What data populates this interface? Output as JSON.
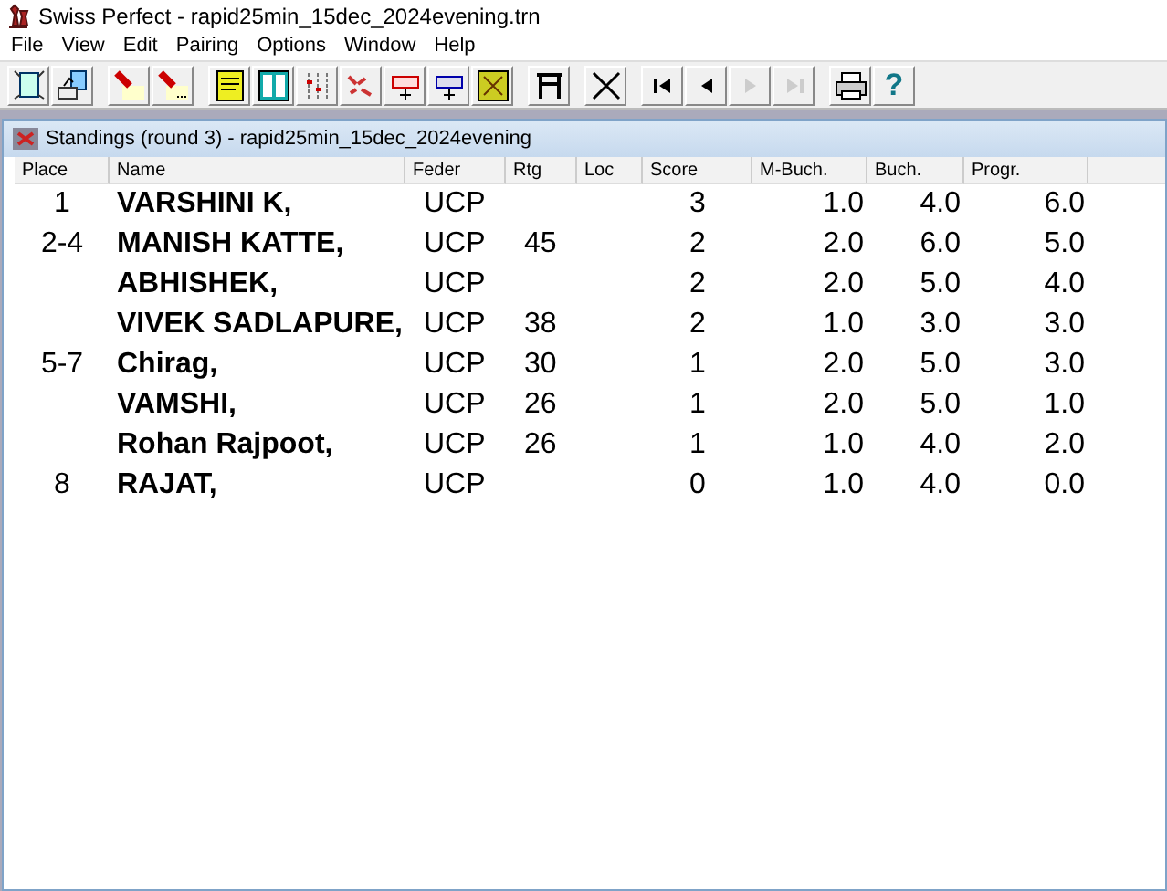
{
  "window": {
    "title": "Swiss Perfect - rapid25min_15dec_2024evening.trn"
  },
  "menu": [
    "File",
    "View",
    "Edit",
    "Pairing",
    "Options",
    "Window",
    "Help"
  ],
  "toolbar": [
    {
      "kind": "new",
      "disabled": false
    },
    {
      "kind": "open",
      "disabled": false
    },
    {
      "kind": "sep"
    },
    {
      "kind": "torch",
      "disabled": false
    },
    {
      "kind": "torch-dots",
      "disabled": false
    },
    {
      "kind": "sep"
    },
    {
      "kind": "notepad",
      "disabled": false
    },
    {
      "kind": "list",
      "disabled": false
    },
    {
      "kind": "dots",
      "disabled": false
    },
    {
      "kind": "scatter",
      "disabled": false
    },
    {
      "kind": "rednum",
      "disabled": false
    },
    {
      "kind": "bluenum",
      "disabled": false
    },
    {
      "kind": "map",
      "disabled": false
    },
    {
      "kind": "sep"
    },
    {
      "kind": "table",
      "disabled": false
    },
    {
      "kind": "sep"
    },
    {
      "kind": "cross",
      "disabled": false
    },
    {
      "kind": "sep"
    },
    {
      "kind": "first",
      "disabled": false
    },
    {
      "kind": "prev",
      "disabled": false
    },
    {
      "kind": "next",
      "disabled": true
    },
    {
      "kind": "last",
      "disabled": true
    },
    {
      "kind": "sep"
    },
    {
      "kind": "printer",
      "disabled": false
    },
    {
      "kind": "help",
      "label": "?",
      "disabled": false
    }
  ],
  "child_window": {
    "title": "Standings  (round 3) - rapid25min_15dec_2024evening"
  },
  "table": {
    "columns": [
      "Place",
      "Name",
      "Feder",
      "Rtg",
      "Loc",
      "Score",
      "M-Buch.",
      "Buch.",
      "Progr."
    ],
    "rows": [
      {
        "place": "1",
        "name": "VARSHINI K,",
        "feder": "UCP",
        "rtg": "",
        "score": "3",
        "m_buch": "1.0",
        "buch": "4.0",
        "progr": "6.0"
      },
      {
        "place": "2-4",
        "name": "MANISH KATTE,",
        "feder": "UCP",
        "rtg": "45",
        "score": "2",
        "m_buch": "2.0",
        "buch": "6.0",
        "progr": "5.0"
      },
      {
        "place": "",
        "name": "ABHISHEK,",
        "feder": "UCP",
        "rtg": "",
        "score": "2",
        "m_buch": "2.0",
        "buch": "5.0",
        "progr": "4.0"
      },
      {
        "place": "",
        "name": "VIVEK SADLAPURE,",
        "feder": "UCP",
        "rtg": "38",
        "score": "2",
        "m_buch": "1.0",
        "buch": "3.0",
        "progr": "3.0"
      },
      {
        "place": "5-7",
        "name": "Chirag,",
        "feder": "UCP",
        "rtg": "30",
        "score": "1",
        "m_buch": "2.0",
        "buch": "5.0",
        "progr": "3.0"
      },
      {
        "place": "",
        "name": "VAMSHI,",
        "feder": "UCP",
        "rtg": "26",
        "score": "1",
        "m_buch": "2.0",
        "buch": "5.0",
        "progr": "1.0"
      },
      {
        "place": "",
        "name": "Rohan Rajpoot,",
        "feder": "UCP",
        "rtg": "26",
        "score": "1",
        "m_buch": "1.0",
        "buch": "4.0",
        "progr": "2.0"
      },
      {
        "place": "8",
        "name": "RAJAT,",
        "feder": "UCP",
        "rtg": "",
        "score": "0",
        "m_buch": "1.0",
        "buch": "4.0",
        "progr": "0.0"
      }
    ]
  }
}
